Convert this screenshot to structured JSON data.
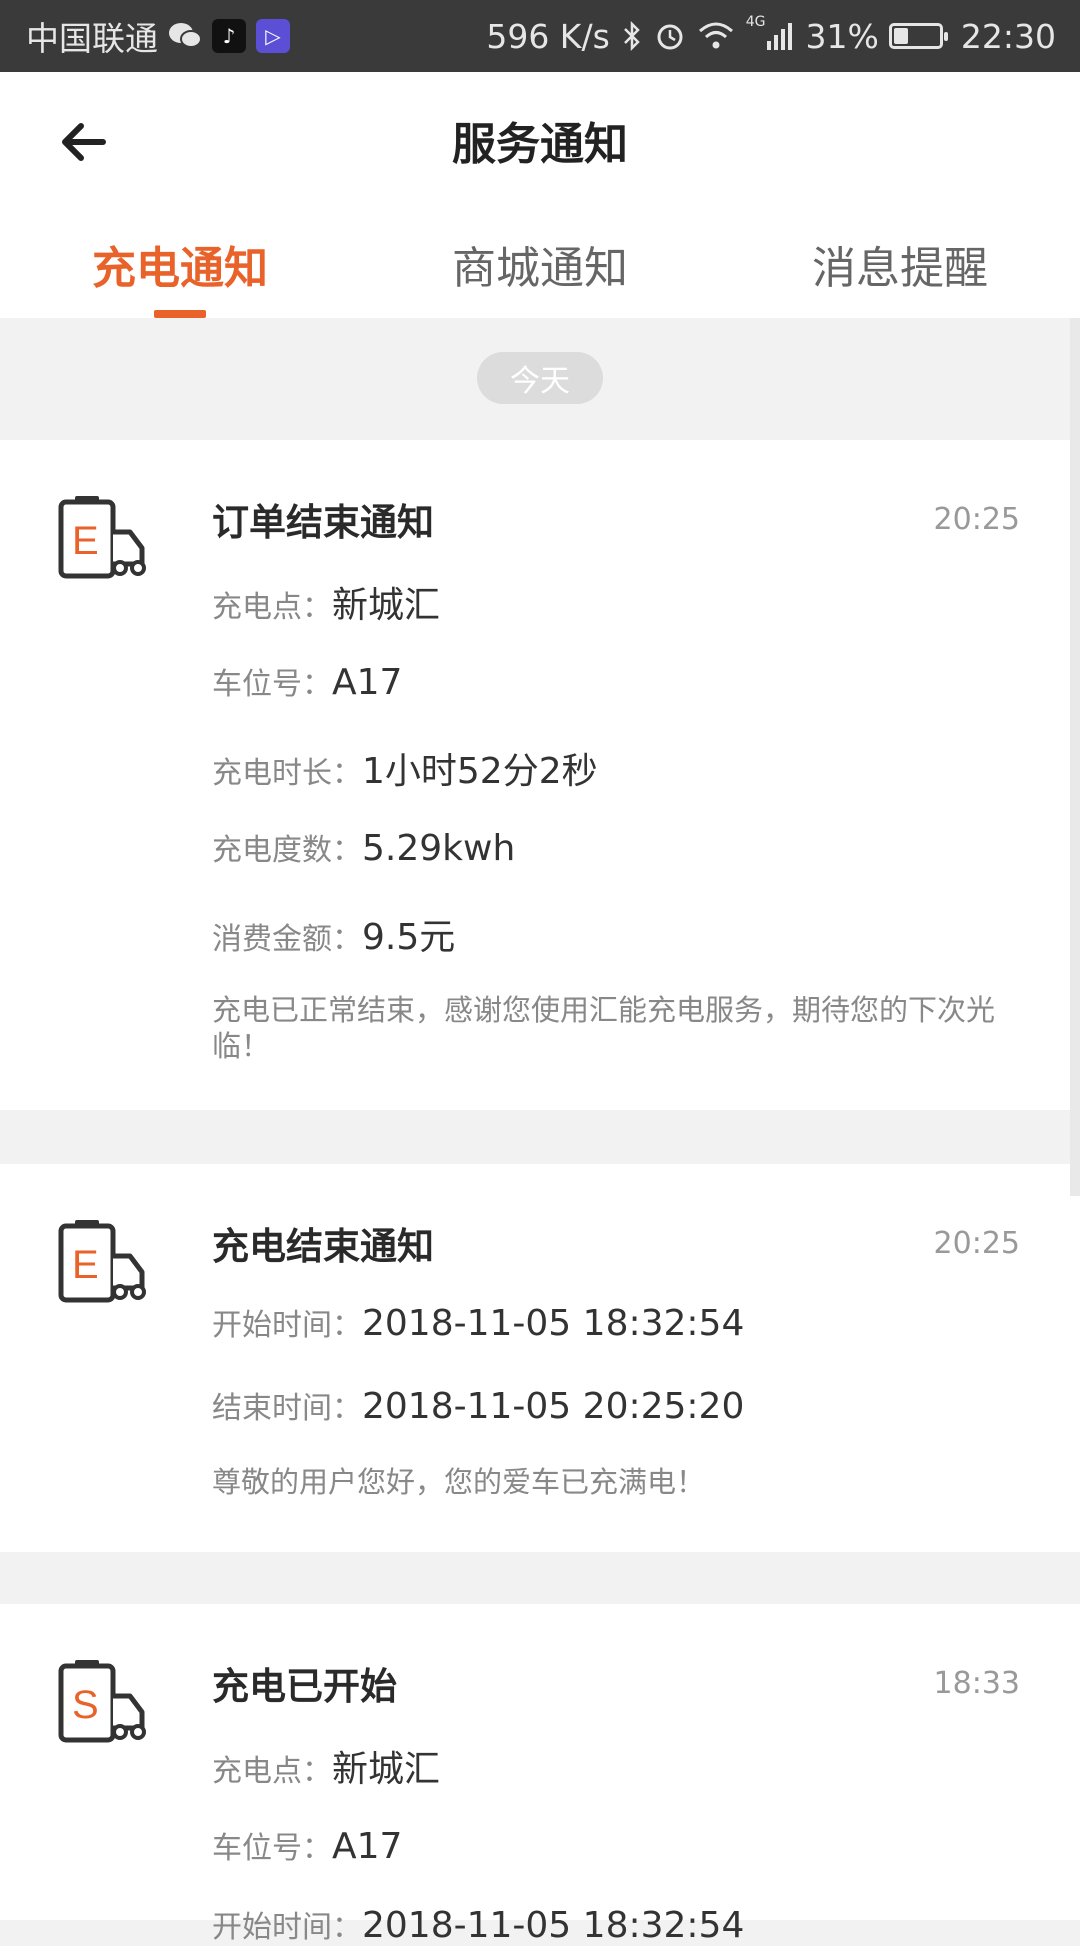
{
  "status_bar": {
    "carrier": "中国联通",
    "speed": "596 K/s",
    "network": "4G",
    "battery": "31%",
    "battery_level": 0.31,
    "time": "22:30",
    "app_icons": [
      "wechat-icon",
      "tiktok-icon",
      "video-app-icon"
    ]
  },
  "header": {
    "title": "服务通知",
    "tabs": [
      {
        "label": "充电通知",
        "active": true
      },
      {
        "label": "商城通知",
        "active": false
      },
      {
        "label": "消息提醒",
        "active": false
      }
    ]
  },
  "day_label": "今天",
  "cards": [
    {
      "icon_letter": "E",
      "title": "订单结束通知",
      "time": "20:25",
      "rows": [
        {
          "label": "充电点：",
          "value": "新城汇"
        },
        {
          "label": "车位号：",
          "value": "A17"
        },
        {
          "label": "充电时长：",
          "value": "1小时52分2秒"
        },
        {
          "label": "充电度数：",
          "value": "5.29kwh"
        },
        {
          "label": "消费金额：",
          "value": "9.5元"
        }
      ],
      "desc": "充电已正常结束，感谢您使用汇能充电服务，期待您的下次光临！"
    },
    {
      "icon_letter": "E",
      "title": "充电结束通知",
      "time": "20:25",
      "rows": [
        {
          "label": "开始时间：",
          "value": "2018-11-05 18:32:54"
        },
        {
          "label": "结束时间：",
          "value": "2018-11-05 20:25:20"
        }
      ],
      "desc": "尊敬的用户您好，您的爱车已充满电！"
    },
    {
      "icon_letter": "S",
      "title": "充电已开始",
      "time": "18:33",
      "rows": [
        {
          "label": "充电点：",
          "value": "新城汇"
        },
        {
          "label": "车位号：",
          "value": "A17"
        },
        {
          "label": "开始时间：",
          "value": "2018-11-05 18:32:54"
        }
      ]
    }
  ],
  "colors": {
    "accent": "#e8622a",
    "status_bar": "#3a3a3a"
  }
}
